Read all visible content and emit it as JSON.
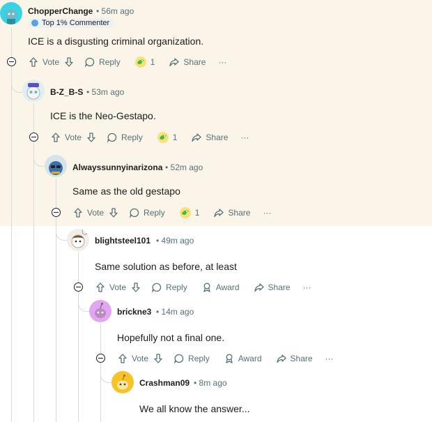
{
  "comments": [
    {
      "username": "ChopperChange",
      "time": "56m ago",
      "badge": "Top 1% Commenter",
      "text": "ICE is a disgusting criminal organization.",
      "vote_label": "Vote",
      "reply_label": "Reply",
      "award_count": "1",
      "share_label": "Share",
      "more": "···"
    },
    {
      "username": "B-Z_B-S",
      "time": "53m ago",
      "text": "ICE is the Neo-Gestapo.",
      "vote_label": "Vote",
      "reply_label": "Reply",
      "award_count": "1",
      "share_label": "Share",
      "more": "···"
    },
    {
      "username": "Alwayssunnyinarizona",
      "time": "52m ago",
      "text": "Same as the old gestapo",
      "vote_label": "Vote",
      "reply_label": "Reply",
      "award_count": "1",
      "share_label": "Share",
      "more": "···"
    },
    {
      "username": "blightsteel101",
      "time": "49m ago",
      "text": "Same solution as before, at least",
      "vote_label": "Vote",
      "reply_label": "Reply",
      "award_label": "Award",
      "share_label": "Share",
      "more": "···"
    },
    {
      "username": "brickne3",
      "time": "14m ago",
      "text": "Hopefully not a final one.",
      "vote_label": "Vote",
      "reply_label": "Reply",
      "award_label": "Award",
      "share_label": "Share",
      "more": "···"
    },
    {
      "username": "Crashman09",
      "time": "8m ago",
      "text": "We all know the answer..."
    }
  ],
  "separator": "•",
  "colors": {
    "highlight_bg": "#faf5e8",
    "thread_line": "#d7dadc",
    "meta_text": "#576f76",
    "award_gold": "#e8c21a"
  }
}
